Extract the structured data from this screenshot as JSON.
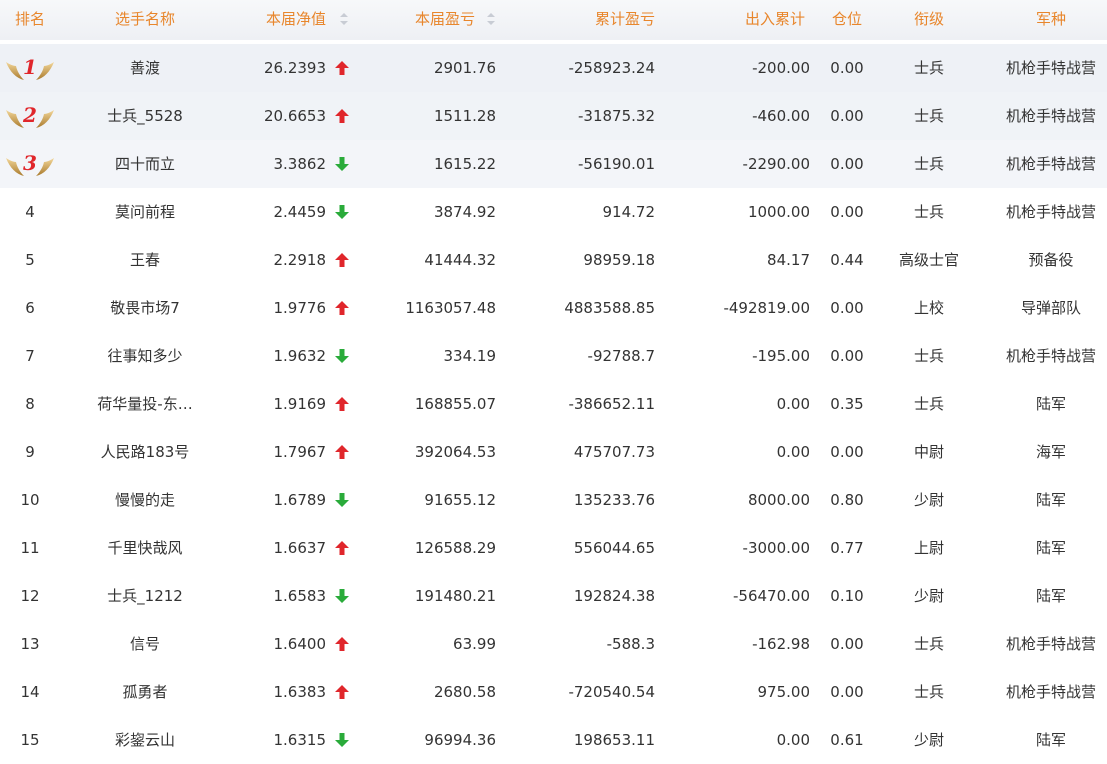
{
  "table": {
    "headers": {
      "rank": "排名",
      "name": "选手名称",
      "nav": "本届净值",
      "profit": "本届盈亏",
      "cumulative": "累计盈亏",
      "flow": "出入累计",
      "position": "仓位",
      "title": "衔级",
      "army": "军种"
    },
    "colors": {
      "header_text": "#e8862c",
      "up_arrow": "#e0262b",
      "down_arrow": "#2aab3a",
      "medal_number": "#e0262b"
    },
    "rows": [
      {
        "rank": "1",
        "medal": true,
        "name": "善渡",
        "nav": "26.2393",
        "trend": "up",
        "profit": "2901.76",
        "cumulative": "-258923.24",
        "flow": "-200.00",
        "position": "0.00",
        "title": "士兵",
        "army": "机枪手特战营"
      },
      {
        "rank": "2",
        "medal": true,
        "name": "士兵_5528",
        "nav": "20.6653",
        "trend": "up",
        "profit": "1511.28",
        "cumulative": "-31875.32",
        "flow": "-460.00",
        "position": "0.00",
        "title": "士兵",
        "army": "机枪手特战营"
      },
      {
        "rank": "3",
        "medal": true,
        "name": "四十而立",
        "nav": "3.3862",
        "trend": "down",
        "profit": "1615.22",
        "cumulative": "-56190.01",
        "flow": "-2290.00",
        "position": "0.00",
        "title": "士兵",
        "army": "机枪手特战营"
      },
      {
        "rank": "4",
        "medal": false,
        "name": "莫问前程",
        "nav": "2.4459",
        "trend": "down",
        "profit": "3874.92",
        "cumulative": "914.72",
        "flow": "1000.00",
        "position": "0.00",
        "title": "士兵",
        "army": "机枪手特战营"
      },
      {
        "rank": "5",
        "medal": false,
        "name": "王春",
        "nav": "2.2918",
        "trend": "up",
        "profit": "41444.32",
        "cumulative": "98959.18",
        "flow": "84.17",
        "position": "0.44",
        "title": "高级士官",
        "army": "预备役"
      },
      {
        "rank": "6",
        "medal": false,
        "name": "敬畏市场7",
        "nav": "1.9776",
        "trend": "up",
        "profit": "1163057.48",
        "cumulative": "4883588.85",
        "flow": "-492819.00",
        "position": "0.00",
        "title": "上校",
        "army": "导弹部队"
      },
      {
        "rank": "7",
        "medal": false,
        "name": "往事知多少",
        "nav": "1.9632",
        "trend": "down",
        "profit": "334.19",
        "cumulative": "-92788.7",
        "flow": "-195.00",
        "position": "0.00",
        "title": "士兵",
        "army": "机枪手特战营"
      },
      {
        "rank": "8",
        "medal": false,
        "name": "荷华量投-东…",
        "nav": "1.9169",
        "trend": "up",
        "profit": "168855.07",
        "cumulative": "-386652.11",
        "flow": "0.00",
        "position": "0.35",
        "title": "士兵",
        "army": "陆军"
      },
      {
        "rank": "9",
        "medal": false,
        "name": "人民路183号",
        "nav": "1.7967",
        "trend": "up",
        "profit": "392064.53",
        "cumulative": "475707.73",
        "flow": "0.00",
        "position": "0.00",
        "title": "中尉",
        "army": "海军"
      },
      {
        "rank": "10",
        "medal": false,
        "name": "慢慢的走",
        "nav": "1.6789",
        "trend": "down",
        "profit": "91655.12",
        "cumulative": "135233.76",
        "flow": "8000.00",
        "position": "0.80",
        "title": "少尉",
        "army": "陆军"
      },
      {
        "rank": "11",
        "medal": false,
        "name": "千里快哉风",
        "nav": "1.6637",
        "trend": "up",
        "profit": "126588.29",
        "cumulative": "556044.65",
        "flow": "-3000.00",
        "position": "0.77",
        "title": "上尉",
        "army": "陆军"
      },
      {
        "rank": "12",
        "medal": false,
        "name": "士兵_1212",
        "nav": "1.6583",
        "trend": "down",
        "profit": "191480.21",
        "cumulative": "192824.38",
        "flow": "-56470.00",
        "position": "0.10",
        "title": "少尉",
        "army": "陆军"
      },
      {
        "rank": "13",
        "medal": false,
        "name": "信号",
        "nav": "1.6400",
        "trend": "up",
        "profit": "63.99",
        "cumulative": "-588.3",
        "flow": "-162.98",
        "position": "0.00",
        "title": "士兵",
        "army": "机枪手特战营"
      },
      {
        "rank": "14",
        "medal": false,
        "name": "孤勇者",
        "nav": "1.6383",
        "trend": "up",
        "profit": "2680.58",
        "cumulative": "-720540.54",
        "flow": "975.00",
        "position": "0.00",
        "title": "士兵",
        "army": "机枪手特战营"
      },
      {
        "rank": "15",
        "medal": false,
        "name": "彩鋆云山",
        "nav": "1.6315",
        "trend": "down",
        "profit": "96994.36",
        "cumulative": "198653.11",
        "flow": "0.00",
        "position": "0.61",
        "title": "少尉",
        "army": "陆军"
      }
    ]
  }
}
